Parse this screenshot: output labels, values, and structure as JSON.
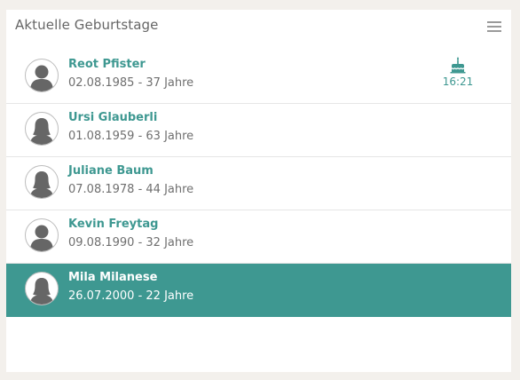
{
  "widget": {
    "title": "Aktuelle Geburtstage",
    "menu_icon": "hamburger-menu-icon"
  },
  "birthdays": [
    {
      "name": "Reot Pfister",
      "info": "02.08.1985 - 37 Jahre",
      "avatar": "male-avatar-icon",
      "today_icon": "birthday-cake-icon",
      "today_time": "16:21",
      "selected": false
    },
    {
      "name": "Ursi Glauberli",
      "info": "01.08.1959 - 63 Jahre",
      "avatar": "female-avatar-icon",
      "selected": false
    },
    {
      "name": "Juliane Baum",
      "info": "07.08.1978 - 44 Jahre",
      "avatar": "female-avatar-icon",
      "selected": false
    },
    {
      "name": "Kevin Freytag",
      "info": "09.08.1990 - 32 Jahre",
      "avatar": "male-avatar-icon",
      "selected": false
    },
    {
      "name": "Mila Milanese",
      "info": "26.07.2000 - 22 Jahre",
      "avatar": "female-avatar-icon",
      "selected": true
    }
  ],
  "colors": {
    "accent": "#3e9891",
    "avatar_fill": "#666666",
    "background": "#f3f0ec"
  }
}
